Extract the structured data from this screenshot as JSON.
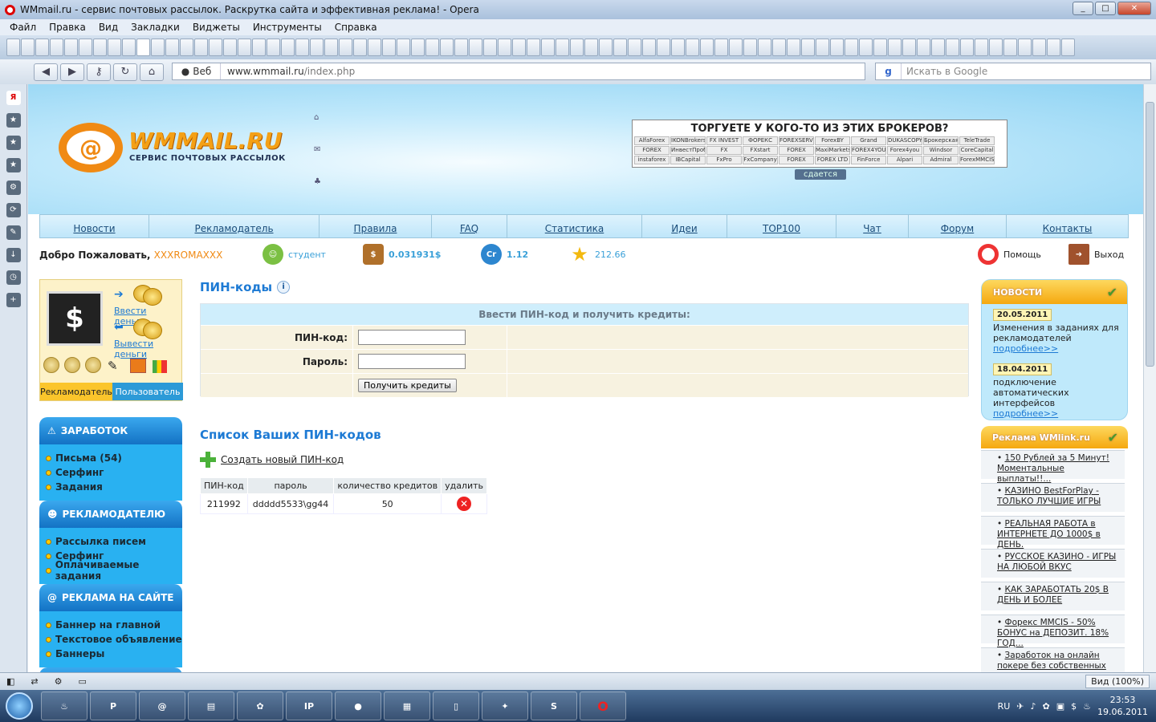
{
  "window": {
    "title": "WMmail.ru - сервис почтовых рассылок. Раскрутка сайта и эффективная реклама! - Opera"
  },
  "menu": [
    "Файл",
    "Правка",
    "Вид",
    "Закладки",
    "Виджеты",
    "Инструменты",
    "Справка"
  ],
  "address": {
    "web_label": "Веб",
    "url_host": "www.wmmail.ru",
    "url_path": "/index.php",
    "search_placeholder": "Искать в Google"
  },
  "site": {
    "logo_text": "WMMAIL.RU",
    "logo_sub": "СЕРВИС ПОЧТОВЫХ РАССЫЛОК",
    "broker_title": "ТОРГУЕТЕ У КОГО-ТО ИЗ ЭТИХ БРОКЕРОВ?",
    "broker_logos": [
      "AlfaForex",
      "IKONBrokers",
      "FX INVEST",
      "ФОРЕКС",
      "FOREXSERVICE",
      "ForexBY",
      "Grand Capital",
      "DUKASCOPY",
      "Брокерская компания",
      "TeleTrade",
      "FOREX",
      "ИнвестПроба",
      "FX",
      "FXstart",
      "FOREX CLUB",
      "MaxiMarkets",
      "FOREX4YOU",
      "Forex4you",
      "Windsor",
      "CoreCapital",
      "instaforex",
      "IBCapital",
      "FxPro",
      "FxCompany",
      "FOREX CLUB",
      "FOREX LTD",
      "FinForce",
      "Alpari",
      "Admiral",
      "ForexMMCIS"
    ],
    "rent_label": "сдается",
    "nav": [
      "Новости",
      "Рекламодатель",
      "Правила",
      "FAQ",
      "Статистика",
      "Идеи",
      "TOP100",
      "Чат",
      "Форум",
      "Контакты"
    ],
    "welcome": "Добро Пожаловать,",
    "username": "XXXROMAXXX",
    "status": "студент",
    "balance": "0.031931$",
    "credits": "1.12",
    "rating": "212.66",
    "help": "Помощь",
    "logout": "Выход"
  },
  "profile": {
    "deposit": "Ввести деньги",
    "withdraw": "Вывести деньги",
    "tab_adv": "Рекламодатель",
    "tab_user": "Пользователь"
  },
  "menus": [
    {
      "title": "ЗАРАБОТОК",
      "items": [
        "Письма (54)",
        "Серфинг",
        "Задания"
      ]
    },
    {
      "title": "РЕКЛАМОДАТЕЛЮ",
      "items": [
        "Рассылка писем",
        "Серфинг",
        "Оплачиваемые задания"
      ]
    },
    {
      "title": "РЕКЛАМА НА САЙТЕ",
      "items": [
        "Баннер на главной",
        "Текстовое объявление",
        "Баннеры"
      ]
    }
  ],
  "pin": {
    "title": "ПИН-коды",
    "form_header": "Ввести ПИН-код и получить кредиты:",
    "pin_label": "ПИН-код:",
    "pass_label": "Пароль:",
    "submit": "Получить кредиты",
    "list_title": "Список Ваших ПИН-кодов",
    "create": "Создать новый ПИН-код",
    "columns": [
      "ПИН-код",
      "пароль",
      "количество кредитов",
      "удалить"
    ],
    "rows": [
      {
        "pin": "211992",
        "password": "ddddd5533\\gg44",
        "credits": "50"
      }
    ]
  },
  "news": {
    "title": "НОВОСТИ",
    "items": [
      {
        "date": "20.05.2011",
        "text": "Изменения в заданиях для рекламодателей",
        "more": "подробнее>>"
      },
      {
        "date": "18.04.2011",
        "text": "подключение автоматических интерфейсов",
        "more": "подробнее>>"
      }
    ]
  },
  "ads": {
    "title": "Реклама WMlink.ru",
    "items": [
      "150 Рублей за 5 Минут! Моментальные выплаты!!...",
      "КАЗИНО BestForPlay - ТОЛЬКО ЛУЧШИЕ ИГРЫ",
      "РЕАЛЬНАЯ РАБОТА в ИНТЕРНЕТЕ ДО 1000$ в ДЕНЬ.",
      "РУССКОЕ КАЗИНО - ИГРЫ НА ЛЮБОЙ ВКУС",
      "КАК ЗАРАБОТАТЬ 20$ В ДЕНЬ И БОЛЕЕ",
      "Форекс MMCIS - 50% БОНУС на ДЕПОЗИТ. 18% ГОД...",
      "Заработок на онлайн покере без собственных вл..."
    ]
  },
  "statusbar": {
    "zoom": "Вид (100%)"
  },
  "taskbar": {
    "lang": "RU",
    "time": "23:53",
    "date": "19.06.2011"
  }
}
